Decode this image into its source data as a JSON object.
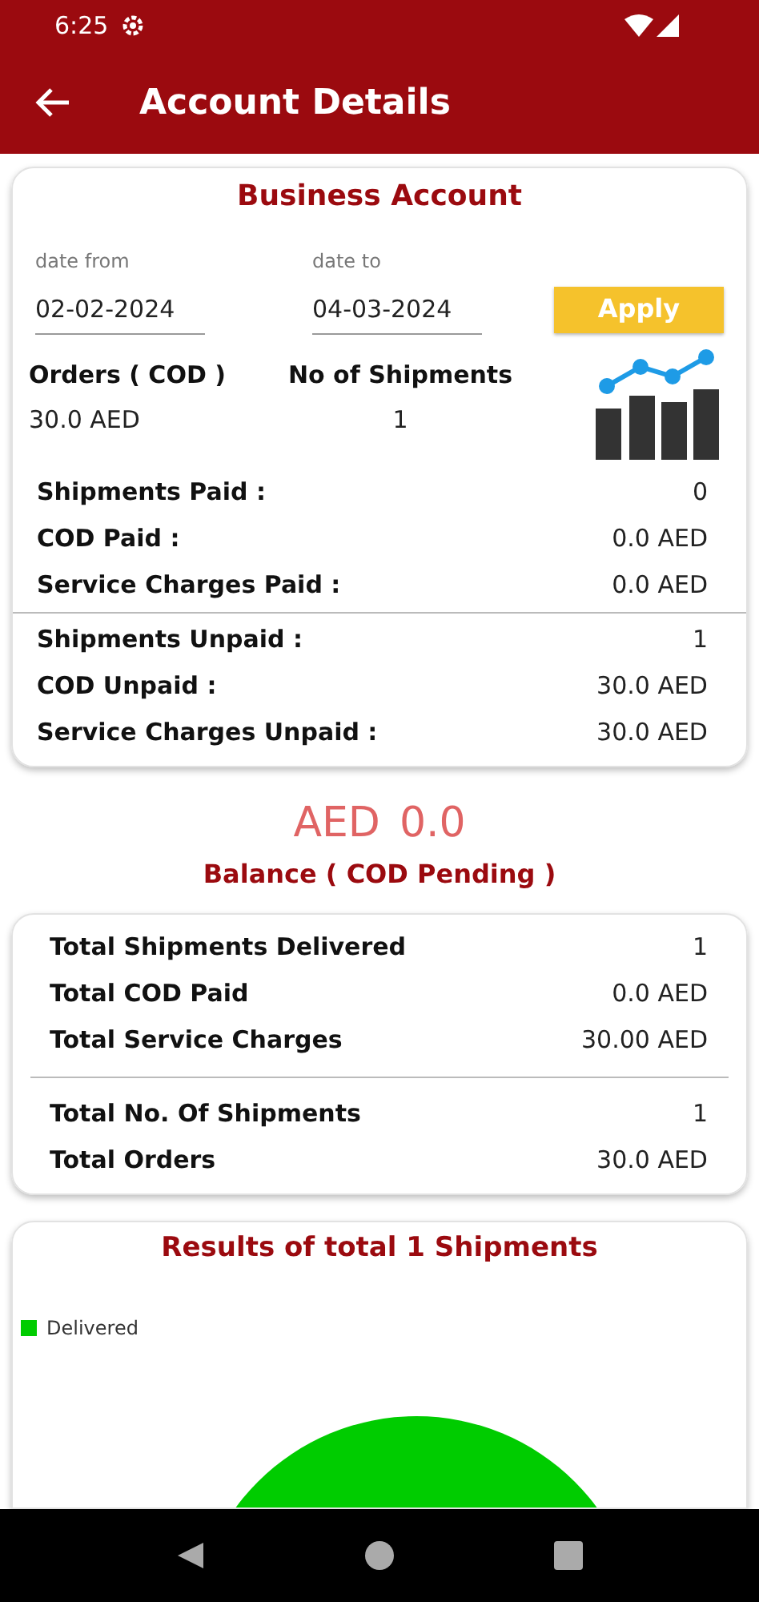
{
  "status_bar": {
    "time": "6:25"
  },
  "app_bar": {
    "title": "Account Details"
  },
  "account_card": {
    "title": "Business Account",
    "date_from": {
      "label": "date from",
      "value": "02-02-2024"
    },
    "date_to": {
      "label": "date to",
      "value": "04-03-2024"
    },
    "apply_button": "Apply",
    "orders": {
      "label": "Orders ( COD )",
      "value": "30.0 AED"
    },
    "shipments": {
      "label": "No of Shipments",
      "value": "1"
    },
    "paid_rows": [
      {
        "label": "Shipments Paid :",
        "value": "0"
      },
      {
        "label": "COD Paid :",
        "value": "0.0 AED"
      },
      {
        "label": "Service Charges Paid :",
        "value": "0.0 AED"
      }
    ],
    "unpaid_rows": [
      {
        "label": "Shipments Unpaid :",
        "value": "1"
      },
      {
        "label": "COD Unpaid :",
        "value": "30.0 AED"
      },
      {
        "label": "Service Charges Unpaid :",
        "value": "30.0 AED"
      }
    ]
  },
  "balance": {
    "currency": "AED",
    "amount": "0.0",
    "label": "Balance ( COD Pending )"
  },
  "totals_card": {
    "top_rows": [
      {
        "label": "Total Shipments Delivered",
        "value": "1"
      },
      {
        "label": "Total COD Paid",
        "value": "0.0 AED"
      },
      {
        "label": "Total Service Charges",
        "value": "30.00 AED"
      }
    ],
    "bottom_rows": [
      {
        "label": "Total No. Of Shipments",
        "value": "1"
      },
      {
        "label": "Total Orders",
        "value": "30.0 AED"
      }
    ]
  },
  "results_card": {
    "title": "Results of total 1 Shipments",
    "legend": [
      {
        "label": "Delivered",
        "color": "#00cc00"
      }
    ]
  }
}
